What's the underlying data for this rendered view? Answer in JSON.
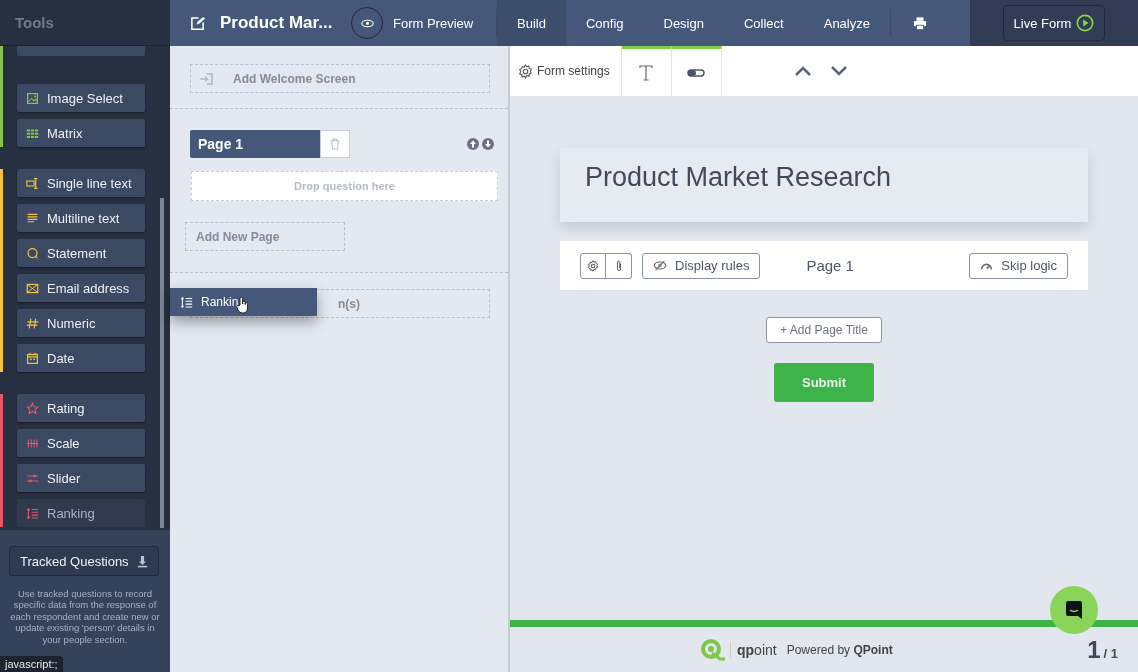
{
  "header": {
    "section_title": "Tools",
    "form_title": "Product Mar...",
    "preview_label": "Form Preview",
    "tabs": [
      {
        "label": "Build",
        "selected": true
      },
      {
        "label": "Config",
        "selected": false
      },
      {
        "label": "Design",
        "selected": false
      },
      {
        "label": "Collect",
        "selected": false
      },
      {
        "label": "Analyze",
        "selected": false
      }
    ],
    "live_button": "Live Form"
  },
  "tools": {
    "groups": [
      {
        "color": "#8bc34a",
        "items": [
          {
            "kind": "image",
            "label": "Image Select",
            "dragging": false
          },
          {
            "kind": "matrix",
            "label": "Matrix",
            "dragging": false
          }
        ]
      },
      {
        "color": "#f0c33c",
        "items": [
          {
            "kind": "single",
            "label": "Single line text",
            "dragging": false
          },
          {
            "kind": "multi",
            "label": "Multiline text",
            "dragging": false
          },
          {
            "kind": "statement",
            "label": "Statement",
            "dragging": false
          },
          {
            "kind": "email",
            "label": "Email address",
            "dragging": false
          },
          {
            "kind": "numeric",
            "label": "Numeric",
            "dragging": false
          },
          {
            "kind": "date",
            "label": "Date",
            "dragging": false
          }
        ]
      },
      {
        "color": "#e8566a",
        "items": [
          {
            "kind": "rating",
            "label": "Rating",
            "dragging": false
          },
          {
            "kind": "scale",
            "label": "Scale",
            "dragging": false
          },
          {
            "kind": "slider",
            "label": "Slider",
            "dragging": false
          },
          {
            "kind": "ranking",
            "label": "Ranking",
            "dragging": true
          }
        ]
      }
    ],
    "tracked_button": "Tracked Questions",
    "tracked_description": "Use tracked questions to record specific data from the response of each respondent and create new or update existing 'person' details in your people section."
  },
  "status_tooltip": "javascript:;",
  "builder": {
    "welcome": "Add Welcome Screen",
    "pages": [
      {
        "label": "Page 1",
        "drop_hint": "Drop question here"
      }
    ],
    "add_page": "Add New Page",
    "end_screen_visible": "n(s)",
    "drag_ghost": "Rankin"
  },
  "canvas": {
    "settings": "Form settings",
    "form_title": "Product Market Research",
    "page_bar": {
      "display_rules": "Display rules",
      "page_label": "Page 1",
      "skip_logic": "Skip logic"
    },
    "add_page_title": "+ Add Page Title",
    "submit": "Submit",
    "progress": {
      "level": 1
    },
    "footer": {
      "brand": "**qp**oint",
      "powered": "Powered by **QPoint**",
      "page_number": "1",
      "page_total": "/ 1"
    }
  }
}
